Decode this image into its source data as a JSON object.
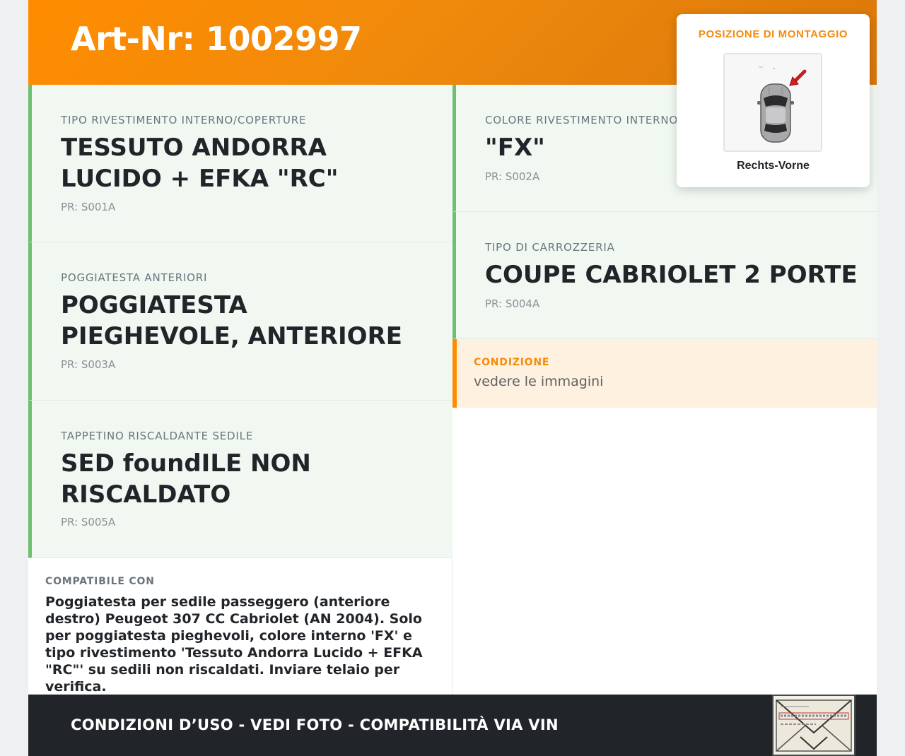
{
  "header": {
    "title": "Art-Nr: 1002997"
  },
  "mount": {
    "title": "POSIZIONE DI MONTAGGIO",
    "caption": "Rechts-Vorne",
    "image_icon": "car-top-view-icon"
  },
  "left_cells": [
    {
      "label": "TIPO RIVESTIMENTO INTERNO/COPERTURE",
      "value": "TESSUTO ANDORRA LUCIDO + EFKA \"RC\"",
      "pr": "PR: S001A"
    },
    {
      "label": "POGGIATESTA ANTERIORI",
      "value": "POGGIATESTA PIEGHEVOLE, ANTERIORE",
      "pr": "PR: S003A"
    },
    {
      "label": "TAPPETINO RISCALDANTE SEDILE",
      "value": "SED foundILE NON RISCALDATO",
      "pr": "PR: S005A"
    }
  ],
  "right_cells": [
    {
      "label": "COLORE RIVESTIMENTO INTERNO",
      "value": "\"FX\"",
      "pr": "PR: S002A"
    },
    {
      "label": "TIPO DI CARROZZERIA",
      "value": "COUPE CABRIOLET 2 PORTE",
      "pr": "PR: S004A"
    }
  ],
  "condition": {
    "label": "CONDIZIONE",
    "text": "vedere le immagini"
  },
  "compat": {
    "label": "COMPATIBILE CON",
    "text": "Poggiatesta per sedile passeggero (anteriore destro) Peugeot 307 CC Cabriolet (AN 2004). Solo per poggiatesta pieghevoli, colore interno 'FX' e tipo rivestimento 'Tessuto Andorra Lucido + EFKA \"RC\"' su sedili non riscaldati. Inviare telaio per verifica."
  },
  "footer": {
    "text": "CONDIZIONI D’USO - VEDI FOTO - COMPATIBILITÀ VIA VIN",
    "stamp_icon": "envelope-stamp-icon"
  },
  "colors": {
    "accent_orange": "#ff8c00",
    "green_border": "#6cc070",
    "cell_bg": "#f1f8f2",
    "footer_bg": "#212529"
  }
}
